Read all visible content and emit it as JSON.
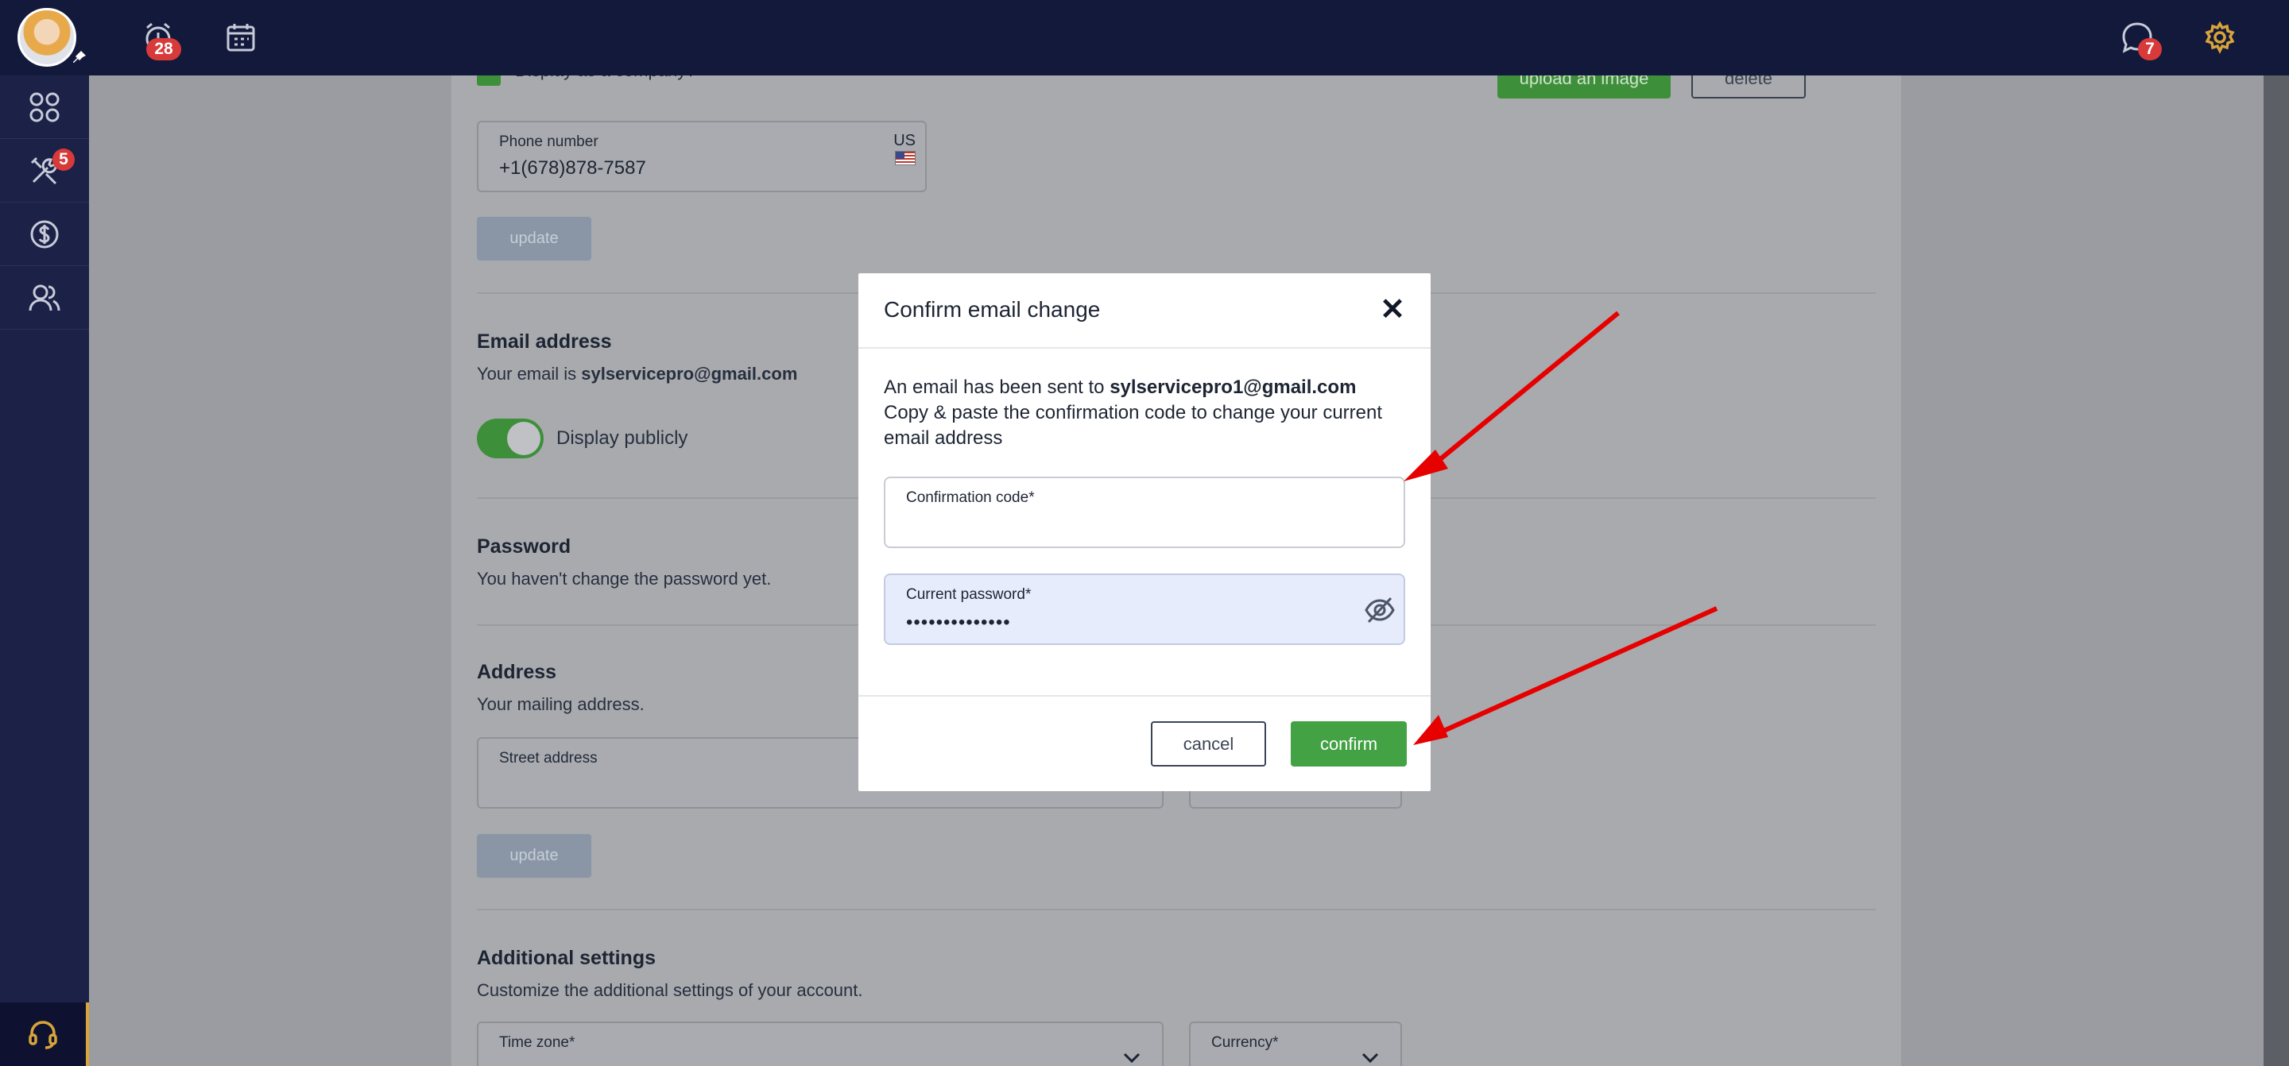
{
  "topbar": {
    "alarm_badge": "28",
    "chat_badge": "7"
  },
  "sidebar": {
    "tools_badge": "5"
  },
  "background": {
    "display_company_label": "Display as a company?",
    "upload_label": "upload an image",
    "delete_label": "delete",
    "phone": {
      "label": "Phone number",
      "value": "+1(678)878-7587",
      "country": "US"
    },
    "update_label": "update",
    "email": {
      "title": "Email address",
      "prefix": "Your email is ",
      "address": "sylservicepro@gmail.com",
      "toggle_label": "Display publicly"
    },
    "password": {
      "title": "Password",
      "subtitle": "You haven't change the password yet."
    },
    "address": {
      "title": "Address",
      "subtitle": "Your mailing address.",
      "street_label": "Street address"
    },
    "additional": {
      "title": "Additional settings",
      "subtitle": "Customize the additional settings of your account.",
      "timezone_label": "Time zone*",
      "currency_label": "Currency*"
    }
  },
  "modal": {
    "title": "Confirm email change",
    "msg_prefix": "An email has been sent to ",
    "msg_email": "sylservicepro1@gmail.com",
    "msg_rest": "Copy & paste the confirmation code to change your current email address",
    "code_label": "Confirmation code*",
    "code_value": "",
    "password_label": "Current password*",
    "password_value": "••••••••••••••",
    "cancel_label": "cancel",
    "confirm_label": "confirm"
  },
  "colors": {
    "topbar": "#13193a",
    "sidebar": "#1c2147",
    "accent_green": "#43a244",
    "badge_red": "#d83a3a",
    "annotation_red": "#e60000"
  },
  "icons": [
    "alarm-clock-icon",
    "calendar-icon",
    "chat-icon",
    "gear-icon",
    "apps-grid-icon",
    "tools-icon",
    "dollar-icon",
    "users-icon",
    "headset-icon",
    "eye-off-icon",
    "close-icon",
    "pin-icon",
    "us-flag-icon",
    "chevron-down-icon"
  ]
}
